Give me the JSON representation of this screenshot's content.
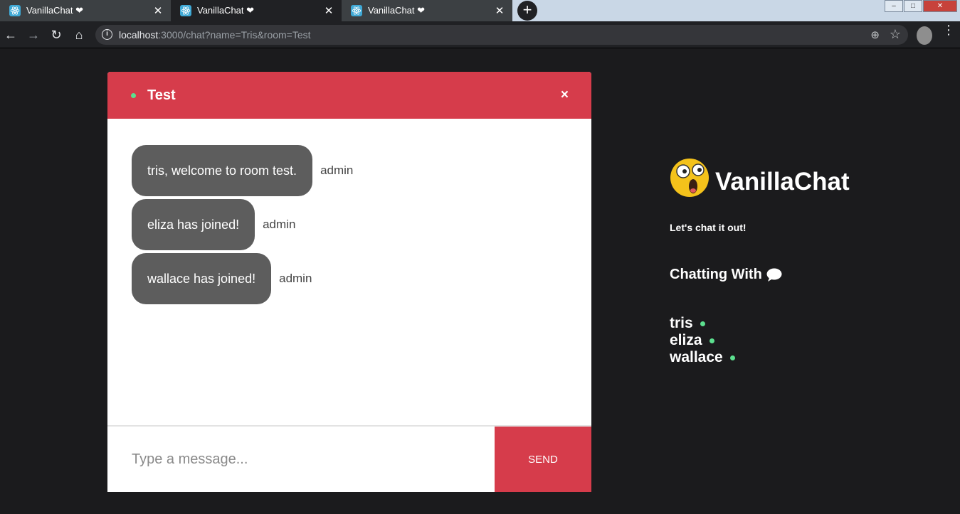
{
  "browser": {
    "tabs": [
      {
        "title": "VanillaChat ❤"
      },
      {
        "title": "VanillaChat ❤"
      },
      {
        "title": "VanillaChat ❤"
      }
    ],
    "new_tab": "+",
    "url_host": "localhost",
    "url_rest": ":3000/chat?name=Tris&room=Test",
    "icons": {
      "back": "←",
      "forward": "→",
      "reload": "↻",
      "home": "⌂",
      "info": "i",
      "zoom": "⊕",
      "star": "☆",
      "menu": "⋮",
      "close": "✕"
    },
    "window_controls": {
      "minimize": "–",
      "maximize": "□",
      "close": "✕"
    }
  },
  "chat": {
    "room": "Test",
    "close": "×",
    "messages": [
      {
        "text": "tris, welcome to room test.",
        "sender": "admin"
      },
      {
        "text": "eliza has joined!",
        "sender": "admin"
      },
      {
        "text": "wallace has joined!",
        "sender": "admin"
      }
    ],
    "input_placeholder": "Type a message...",
    "send_label": "SEND"
  },
  "sidebar": {
    "brand": "VanillaChat",
    "tagline": "Let's chat it out!",
    "chatting_with": "Chatting With",
    "users": [
      "tris",
      "eliza",
      "wallace"
    ]
  },
  "colors": {
    "accent": "#d63c4b",
    "online": "#5ce08f",
    "bubble": "#5d5d5d",
    "page_bg": "#1b1b1d"
  }
}
